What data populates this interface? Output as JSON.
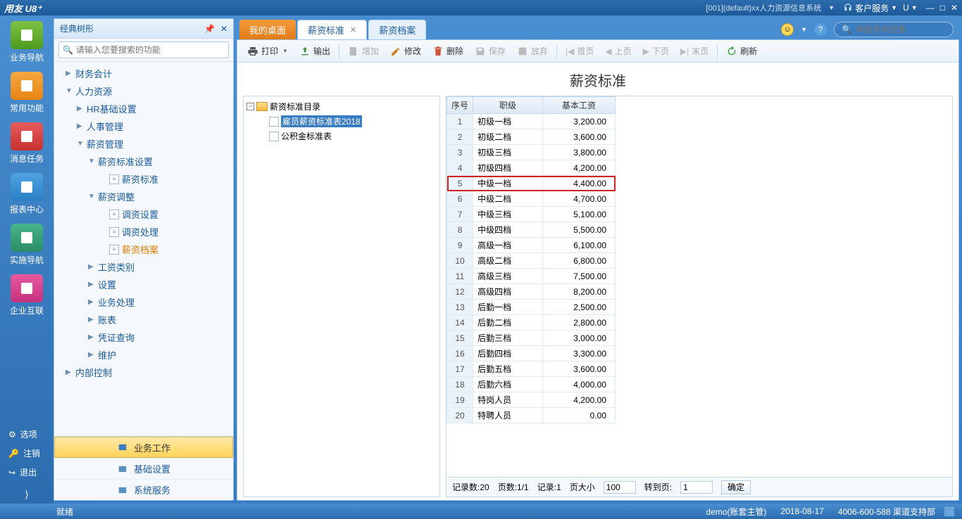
{
  "titlebar": {
    "logo": "用友 U8⁺",
    "system_info": "[001](default)xx人力资源信息系统",
    "service": "客户服务",
    "u_menu": "U"
  },
  "rail": {
    "items": [
      {
        "label": "业务导航",
        "color": "green"
      },
      {
        "label": "常用功能",
        "color": "orange"
      },
      {
        "label": "消息任务",
        "color": "red"
      },
      {
        "label": "报表中心",
        "color": "blue"
      },
      {
        "label": "实施导航",
        "color": "teal"
      },
      {
        "label": "企业互联",
        "color": "pink"
      }
    ],
    "bottom": [
      {
        "label": "选项",
        "icon": "gear"
      },
      {
        "label": "注销",
        "icon": "key"
      },
      {
        "label": "退出",
        "icon": "exit"
      }
    ]
  },
  "sidebar": {
    "title": "经典树形",
    "search_placeholder": "请输入您要搜索的功能",
    "tree": [
      {
        "lv": 1,
        "tg": "▶",
        "label": "财务会计"
      },
      {
        "lv": 1,
        "tg": "▼",
        "label": "人力资源"
      },
      {
        "lv": 2,
        "tg": "▶",
        "label": "HR基础设置"
      },
      {
        "lv": 2,
        "tg": "▶",
        "label": "人事管理"
      },
      {
        "lv": 2,
        "tg": "▼",
        "label": "薪资管理"
      },
      {
        "lv": 3,
        "tg": "▼",
        "label": "薪资标准设置"
      },
      {
        "lv": 4,
        "tg": "",
        "label": "薪资标准",
        "doc": true
      },
      {
        "lv": 3,
        "tg": "▼",
        "label": "薪资调整"
      },
      {
        "lv": 4,
        "tg": "",
        "label": "调资设置",
        "doc": true
      },
      {
        "lv": 4,
        "tg": "",
        "label": "调资处理",
        "doc": true
      },
      {
        "lv": 4,
        "tg": "",
        "label": "薪资档案",
        "doc": true,
        "active": true
      },
      {
        "lv": 3,
        "tg": "▶",
        "label": "工资类别"
      },
      {
        "lv": 3,
        "tg": "▶",
        "label": "设置"
      },
      {
        "lv": 3,
        "tg": "▶",
        "label": "业务处理"
      },
      {
        "lv": 3,
        "tg": "▶",
        "label": "账表"
      },
      {
        "lv": 3,
        "tg": "▶",
        "label": "凭证查询"
      },
      {
        "lv": 3,
        "tg": "▶",
        "label": "维护"
      },
      {
        "lv": 1,
        "tg": "▶",
        "label": "内部控制"
      }
    ],
    "footer": [
      {
        "label": "业务工作",
        "active": true
      },
      {
        "label": "基础设置"
      },
      {
        "label": "系统服务"
      }
    ]
  },
  "tabs": {
    "desktop": "我的桌面",
    "active": "薪资标准",
    "other": "薪资档案"
  },
  "topsearch": {
    "placeholder": "单据条码搜索"
  },
  "toolbar": {
    "print": "打印",
    "output": "输出",
    "add": "增加",
    "edit": "修改",
    "delete": "删除",
    "save": "保存",
    "discard": "放弃",
    "first": "首页",
    "prev": "上页",
    "next": "下页",
    "last": "末页",
    "refresh": "刷新"
  },
  "page": {
    "title": "薪资标准"
  },
  "dirtree": {
    "root": "薪资标准目录",
    "children": [
      {
        "label": "雇员薪资标准表2018",
        "selected": true
      },
      {
        "label": "公积金标准表"
      }
    ]
  },
  "grid": {
    "headers": {
      "seq": "序号",
      "level": "职级",
      "salary": "基本工资"
    },
    "rows": [
      {
        "seq": 1,
        "level": "初级一档",
        "salary": "3,200.00"
      },
      {
        "seq": 2,
        "level": "初级二档",
        "salary": "3,600.00"
      },
      {
        "seq": 3,
        "level": "初级三档",
        "salary": "3,800.00"
      },
      {
        "seq": 4,
        "level": "初级四档",
        "salary": "4,200.00"
      },
      {
        "seq": 5,
        "level": "中级一档",
        "salary": "4,400.00",
        "hl": true
      },
      {
        "seq": 6,
        "level": "中级二档",
        "salary": "4,700.00"
      },
      {
        "seq": 7,
        "level": "中级三档",
        "salary": "5,100.00"
      },
      {
        "seq": 8,
        "level": "中级四档",
        "salary": "5,500.00"
      },
      {
        "seq": 9,
        "level": "高级一档",
        "salary": "6,100.00"
      },
      {
        "seq": 10,
        "level": "高级二档",
        "salary": "6,800.00"
      },
      {
        "seq": 11,
        "level": "高级三档",
        "salary": "7,500.00"
      },
      {
        "seq": 12,
        "level": "高级四档",
        "salary": "8,200.00"
      },
      {
        "seq": 13,
        "level": "后勤一档",
        "salary": "2,500.00"
      },
      {
        "seq": 14,
        "level": "后勤二档",
        "salary": "2,800.00"
      },
      {
        "seq": 15,
        "level": "后勤三档",
        "salary": "3,000.00"
      },
      {
        "seq": 16,
        "level": "后勤四档",
        "salary": "3,300.00"
      },
      {
        "seq": 17,
        "level": "后勤五档",
        "salary": "3,600.00"
      },
      {
        "seq": 18,
        "level": "后勤六档",
        "salary": "4,000.00"
      },
      {
        "seq": 19,
        "level": "特岗人员",
        "salary": "4,200.00"
      },
      {
        "seq": 20,
        "level": "特聘人员",
        "salary": "0.00"
      }
    ]
  },
  "pager": {
    "records_lbl": "记录数:",
    "records": "20",
    "pages_lbl": "页数:",
    "pages": "1/1",
    "record_lbl": "记录:",
    "record": "1",
    "size_lbl": "页大小",
    "size": "100",
    "goto_lbl": "转到页:",
    "goto": "1",
    "ok": "确定"
  },
  "status": {
    "ready": "就绪",
    "user": "demo(账套主管)",
    "date": "2018-08-17",
    "support": "4006-600-588 渠道支持部"
  }
}
